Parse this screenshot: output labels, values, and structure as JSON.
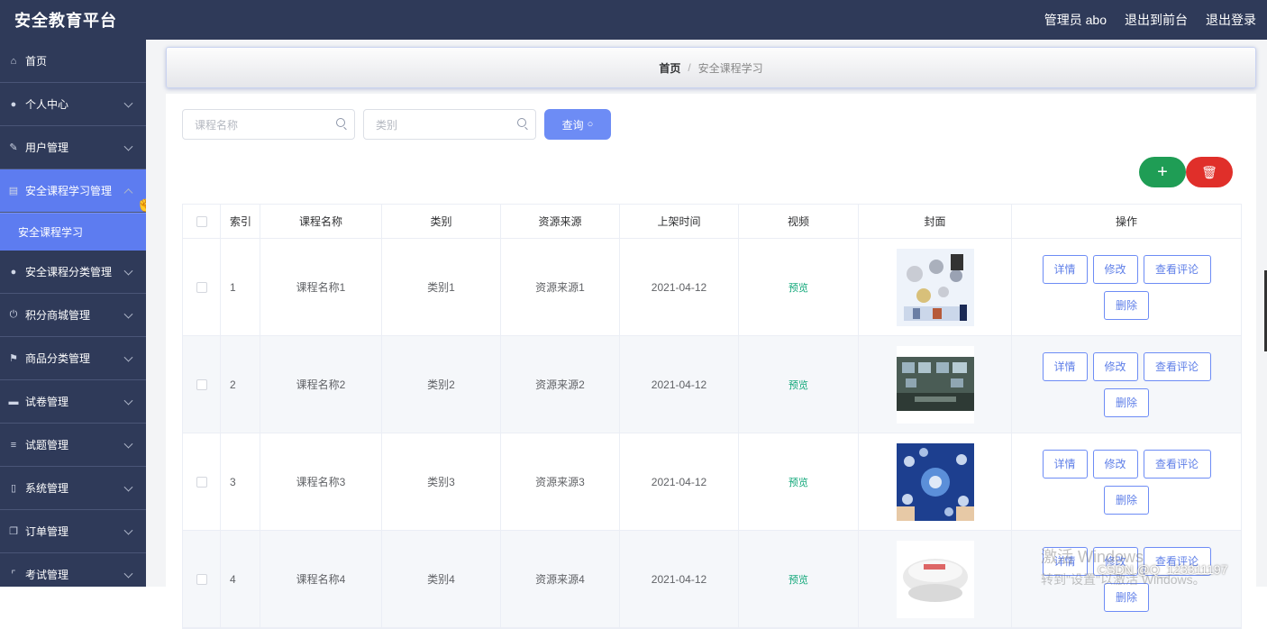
{
  "header": {
    "title": "安全教育平台",
    "user_label": "管理员 abo",
    "front_link": "退出到前台",
    "logout_link": "退出登录"
  },
  "sidebar": {
    "items": [
      {
        "label": "首页",
        "icon": "home-icon"
      },
      {
        "label": "个人中心",
        "icon": "user-icon"
      },
      {
        "label": "用户管理",
        "icon": "pen-icon"
      },
      {
        "label": "安全课程学习管理",
        "icon": "document-icon",
        "active": true
      },
      {
        "label": "安全课程分类管理",
        "icon": "user-icon"
      },
      {
        "label": "积分商城管理",
        "icon": "power-icon"
      },
      {
        "label": "商品分类管理",
        "icon": "flag-icon"
      },
      {
        "label": "试卷管理",
        "icon": "briefcase-icon"
      },
      {
        "label": "试题管理",
        "icon": "list-icon"
      },
      {
        "label": "系统管理",
        "icon": "mic-icon"
      },
      {
        "label": "订单管理",
        "icon": "copy-icon"
      },
      {
        "label": "考试管理",
        "icon": "bracket-icon"
      }
    ],
    "sub_item": "安全课程学习"
  },
  "breadcrumb": {
    "home": "首页",
    "separator": "/",
    "current": "安全课程学习"
  },
  "search": {
    "name_placeholder": "课程名称",
    "category_placeholder": "类别",
    "query_label": "查询"
  },
  "actions": {
    "add_symbol": "+",
    "delete_symbol": "🗑"
  },
  "table": {
    "headers": [
      "索引",
      "课程名称",
      "类别",
      "资源来源",
      "上架时间",
      "视频",
      "封面",
      "操作"
    ],
    "rows": [
      {
        "index": "1",
        "name": "课程名称1",
        "category": "类别1",
        "source": "资源来源1",
        "date": "2021-04-12",
        "video": "预览"
      },
      {
        "index": "2",
        "name": "课程名称2",
        "category": "类别2",
        "source": "资源来源2",
        "date": "2021-04-12",
        "video": "预览"
      },
      {
        "index": "3",
        "name": "课程名称3",
        "category": "类别3",
        "source": "资源来源3",
        "date": "2021-04-12",
        "video": "预览"
      },
      {
        "index": "4",
        "name": "课程名称4",
        "category": "类别4",
        "source": "资源来源4",
        "date": "2021-04-12",
        "video": "预览"
      }
    ],
    "row_actions": {
      "detail": "详情",
      "edit": "修改",
      "comments": "查看评论",
      "delete": "删除"
    }
  },
  "overlay": {
    "activate_windows": "激活 Windows",
    "activate_hint": "转到\"设置\"以激活 Windows。",
    "csdn": "CSDN @Q_123311197"
  },
  "colors": {
    "sidebar_bg": "#2f3a59",
    "active_menu": "#5d7cf0",
    "primary": "#6d8cf5",
    "add_button": "#1f9d55",
    "delete_button": "#e02f2a",
    "preview_text": "#12a87a"
  }
}
